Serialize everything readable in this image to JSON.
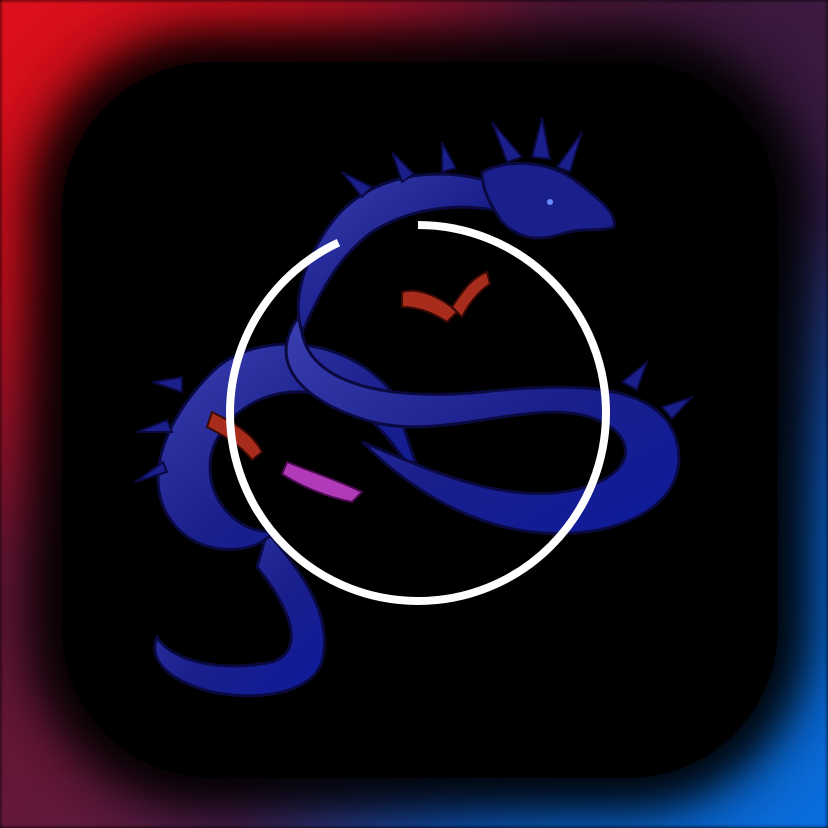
{
  "screen": {
    "wallpaper_colors": [
      "#e0101c",
      "#5a1840",
      "#1c3c9e",
      "#0b66d6"
    ]
  },
  "app_icon": {
    "icon_name": "dragon-icon",
    "background_color": "#000000",
    "dragon_colors": {
      "body": "#1a1f8c",
      "body_highlight": "#3b3fb0",
      "claws": "#a82c1c",
      "tongue": "#b03ab8"
    }
  },
  "download_progress": {
    "icon_name": "progress-ring-icon",
    "progress_fraction": 0.93,
    "ring_color": "#ffffff"
  }
}
